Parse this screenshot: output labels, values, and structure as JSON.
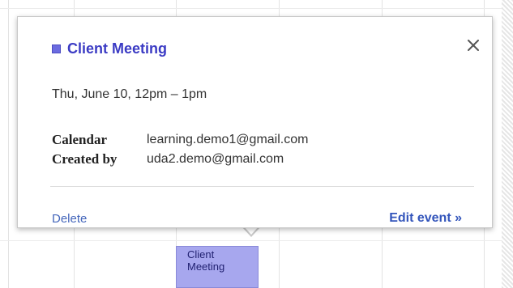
{
  "event": {
    "title": "Client Meeting",
    "color": "#6b6be0",
    "when": "Thu, June 10, 12pm – 1pm"
  },
  "details": [
    {
      "label": "Calendar",
      "value": "learning.demo1@gmail.com"
    },
    {
      "label": "Created by",
      "value": "uda2.demo@gmail.com"
    }
  ],
  "actions": {
    "delete_label": "Delete",
    "edit_label": "Edit event »",
    "close_icon": "close-icon"
  },
  "calendar_block": {
    "label": "Client\nMeeting",
    "color": "#a7a7ee"
  },
  "colors": {
    "link": "#3355bb",
    "title": "#3b3bc4"
  }
}
